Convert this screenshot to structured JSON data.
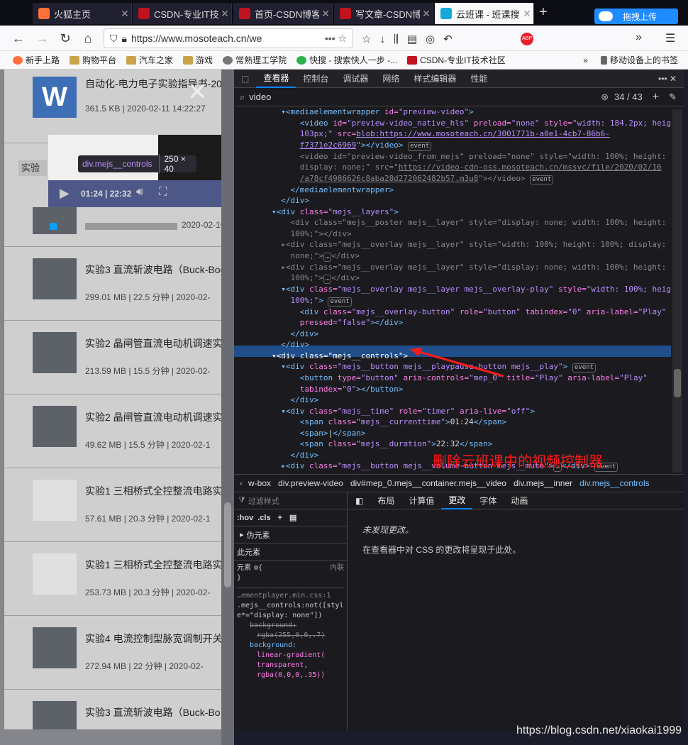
{
  "tabs": [
    {
      "title": "火狐主页",
      "color": "#ff7139"
    },
    {
      "title": "CSDN-专业IT技",
      "color": "#c1121f"
    },
    {
      "title": "首页-CSDN博客",
      "color": "#c1121f"
    },
    {
      "title": "写文章-CSDN博",
      "color": "#c1121f"
    },
    {
      "title": "云班课 - 班课搜",
      "color": "#14a9d9"
    }
  ],
  "upload_label": "拖拽上传",
  "url": "https://www.mosoteach.cn/we",
  "bookmarks": [
    "新手上路",
    "购物平台",
    "汽车之家",
    "游戏",
    "常熟理工学院",
    "快搜 - 搜索快人一步 -...",
    "CSDN-专业IT技术社区"
  ],
  "mobile_bookmarks": "移动设备上的书签",
  "resources": [
    {
      "title": "自动化-电力电子实验指导书-20",
      "size": "361.5 KB",
      "time": "2020-02-11 14:22:27"
    },
    {
      "title": "实验",
      "size": "",
      "time": "2020-02-16"
    },
    {
      "title": "实验3 直流斩波电路（Buck-Boo",
      "size": "299.01 MB",
      "duration": "22.5 分钟",
      "time": "2020-02-"
    },
    {
      "title": "实验2 晶闸管直流电动机调速实",
      "size": "213.59 MB",
      "duration": "15.5 分钟",
      "time": "2020-02-"
    },
    {
      "title": "实验2 晶闸管直流电动机调速实",
      "size": "49.62 MB",
      "duration": "15.5 分钟",
      "time": "2020-02-1"
    },
    {
      "title": "实验1 三相桥式全控整流电路实",
      "size": "57.61 MB",
      "duration": "20.3 分钟",
      "time": "2020-02-1"
    },
    {
      "title": "实验1 三相桥式全控整流电路实",
      "size": "253.73 MB",
      "duration": "20.3 分钟",
      "time": "2020-02-"
    },
    {
      "title": "实验4 电流控制型脉宽调制开关",
      "size": "272.94 MB",
      "duration": "22 分钟",
      "time": "2020-02-"
    },
    {
      "title": "实验3 直流斩波电路（Buck-Bo",
      "size": "",
      "duration": "",
      "time": ""
    }
  ],
  "player": {
    "time": "01:24 | 22:32",
    "tooltip_el": "div.mejs__controls",
    "tooltip_size": "250 × 40"
  },
  "devtools": {
    "tabs": [
      "查看器",
      "控制台",
      "调试器",
      "网络",
      "样式编辑器",
      "性能"
    ],
    "search_value": "video",
    "search_count": "34 / 43",
    "breadcrumbs": [
      "w-box",
      "div.preview-video",
      "div#mep_0.mejs__container.mejs__video",
      "div.mejs__inner",
      "div.mejs__controls"
    ],
    "filter_placeholder": "过滤样式",
    "hov": ":hov",
    "cls": ".cls",
    "pseudo": "伪元素",
    "this_element": "此元素",
    "element": "元素",
    "inline": "内联",
    "rule_source": "…ementplayer.min.css:1",
    "rule_selector": ".mejs__controls:not([style*=\"display: none\"])",
    "prop1": "background:",
    "val1": "rgba(255,0,0,.7)",
    "prop2": "background:",
    "val2a": "linear-gradient(",
    "val2b": "transparent,",
    "val2c": "rgba(0,0,0,.35))",
    "right_tabs": [
      "布局",
      "计算值",
      "更改",
      "字体",
      "动画"
    ],
    "no_changes": "未发现更改。",
    "changes_hint": "在查看器中对 CSS 的更改将呈现于此处。"
  },
  "annotation": "删除云班课中的视频控制器",
  "watermark": "https://blog.csdn.net/xiaokai1999",
  "event_badge": "event"
}
